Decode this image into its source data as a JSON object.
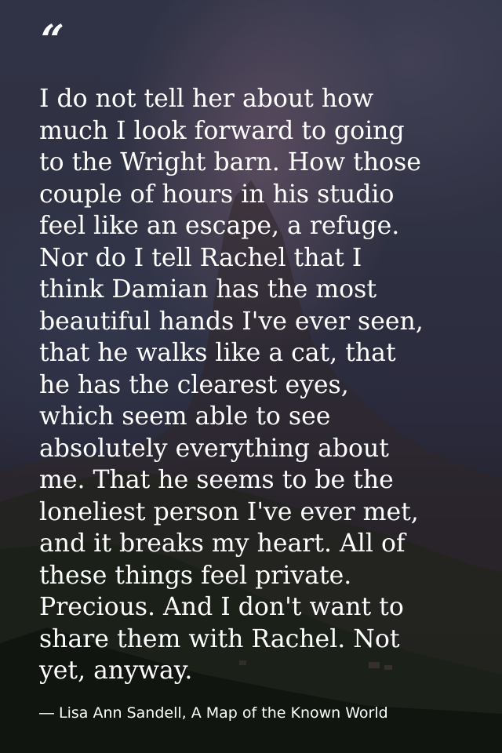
{
  "quote": {
    "mark": "“",
    "text": "I do not tell her about how\nmuch I look forward to going\nto the Wright barn. How those\ncouple of hours in his studio\nfeel like an escape, a refuge.\nNor do I tell Rachel that I\nthink Damian has the most\nbeautiful hands I've ever seen,\nthat he walks like a cat, that\nhe has the clearest eyes,\nwhich seem able to see\nabsolutely everything about\nme. That he seems to be the\nloneliest person I've ever met,\nand it breaks my heart. All of\nthese things feel private.\nPrecious. And I don't want to\nshare them with Rachel. Not\nyet, anyway.",
    "attribution": "― Lisa Ann Sandell, A Map of the Known World"
  },
  "colors": {
    "text": "#ffffff",
    "sky": "#3a3d52",
    "ground": "#151a1a"
  }
}
